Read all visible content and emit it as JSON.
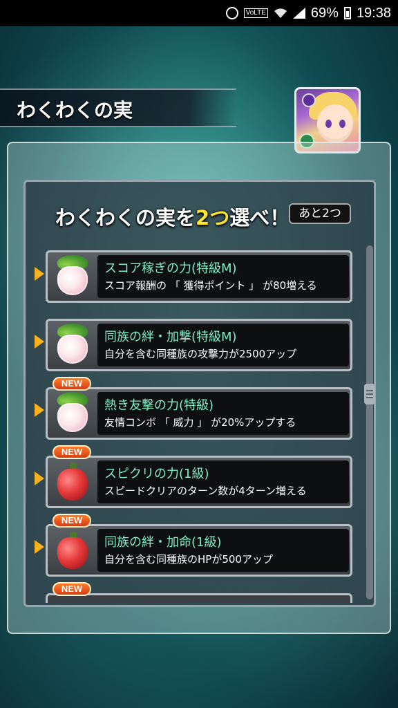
{
  "status_bar": {
    "network_label": "VoLTE",
    "battery": "69%",
    "time": "19:38"
  },
  "title": "わくわくの実",
  "heading": {
    "prefix": "わくわくの実を",
    "count": "2つ",
    "suffix": "選べ！",
    "remaining": "あと2つ"
  },
  "items": [
    {
      "name": "スコア稼ぎの力(特級M)",
      "desc": "スコア報酬の 「 獲得ポイント 」 が80増える",
      "fruit": "white-fruit-icon",
      "is_new": false,
      "new_label": ""
    },
    {
      "name": "同族の絆・加撃(特級M)",
      "desc": "自分を含む同種族の攻撃力が2500アップ",
      "fruit": "white-fruit-icon",
      "is_new": false,
      "new_label": ""
    },
    {
      "name": "熱き友撃の力(特級)",
      "desc": "友情コンボ 「 威力 」 が20%アップする",
      "fruit": "white-fruit-icon",
      "is_new": true,
      "new_label": "NEW"
    },
    {
      "name": "スピクリの力(1級)",
      "desc": "スピードクリアのターン数が4ターン増える",
      "fruit": "red-fruit-icon",
      "is_new": true,
      "new_label": "NEW"
    },
    {
      "name": "同族の絆・加命(1級)",
      "desc": "自分を含む同種族のHPが500アップ",
      "fruit": "red-fruit-icon",
      "is_new": true,
      "new_label": "NEW"
    }
  ],
  "partial_item": {
    "new_label": "NEW"
  },
  "colors": {
    "accent_yellow": "#ffe62e",
    "item_title": "#7ff0c8",
    "new_badge": "#e24a17",
    "arrow": "#f7b21e"
  }
}
